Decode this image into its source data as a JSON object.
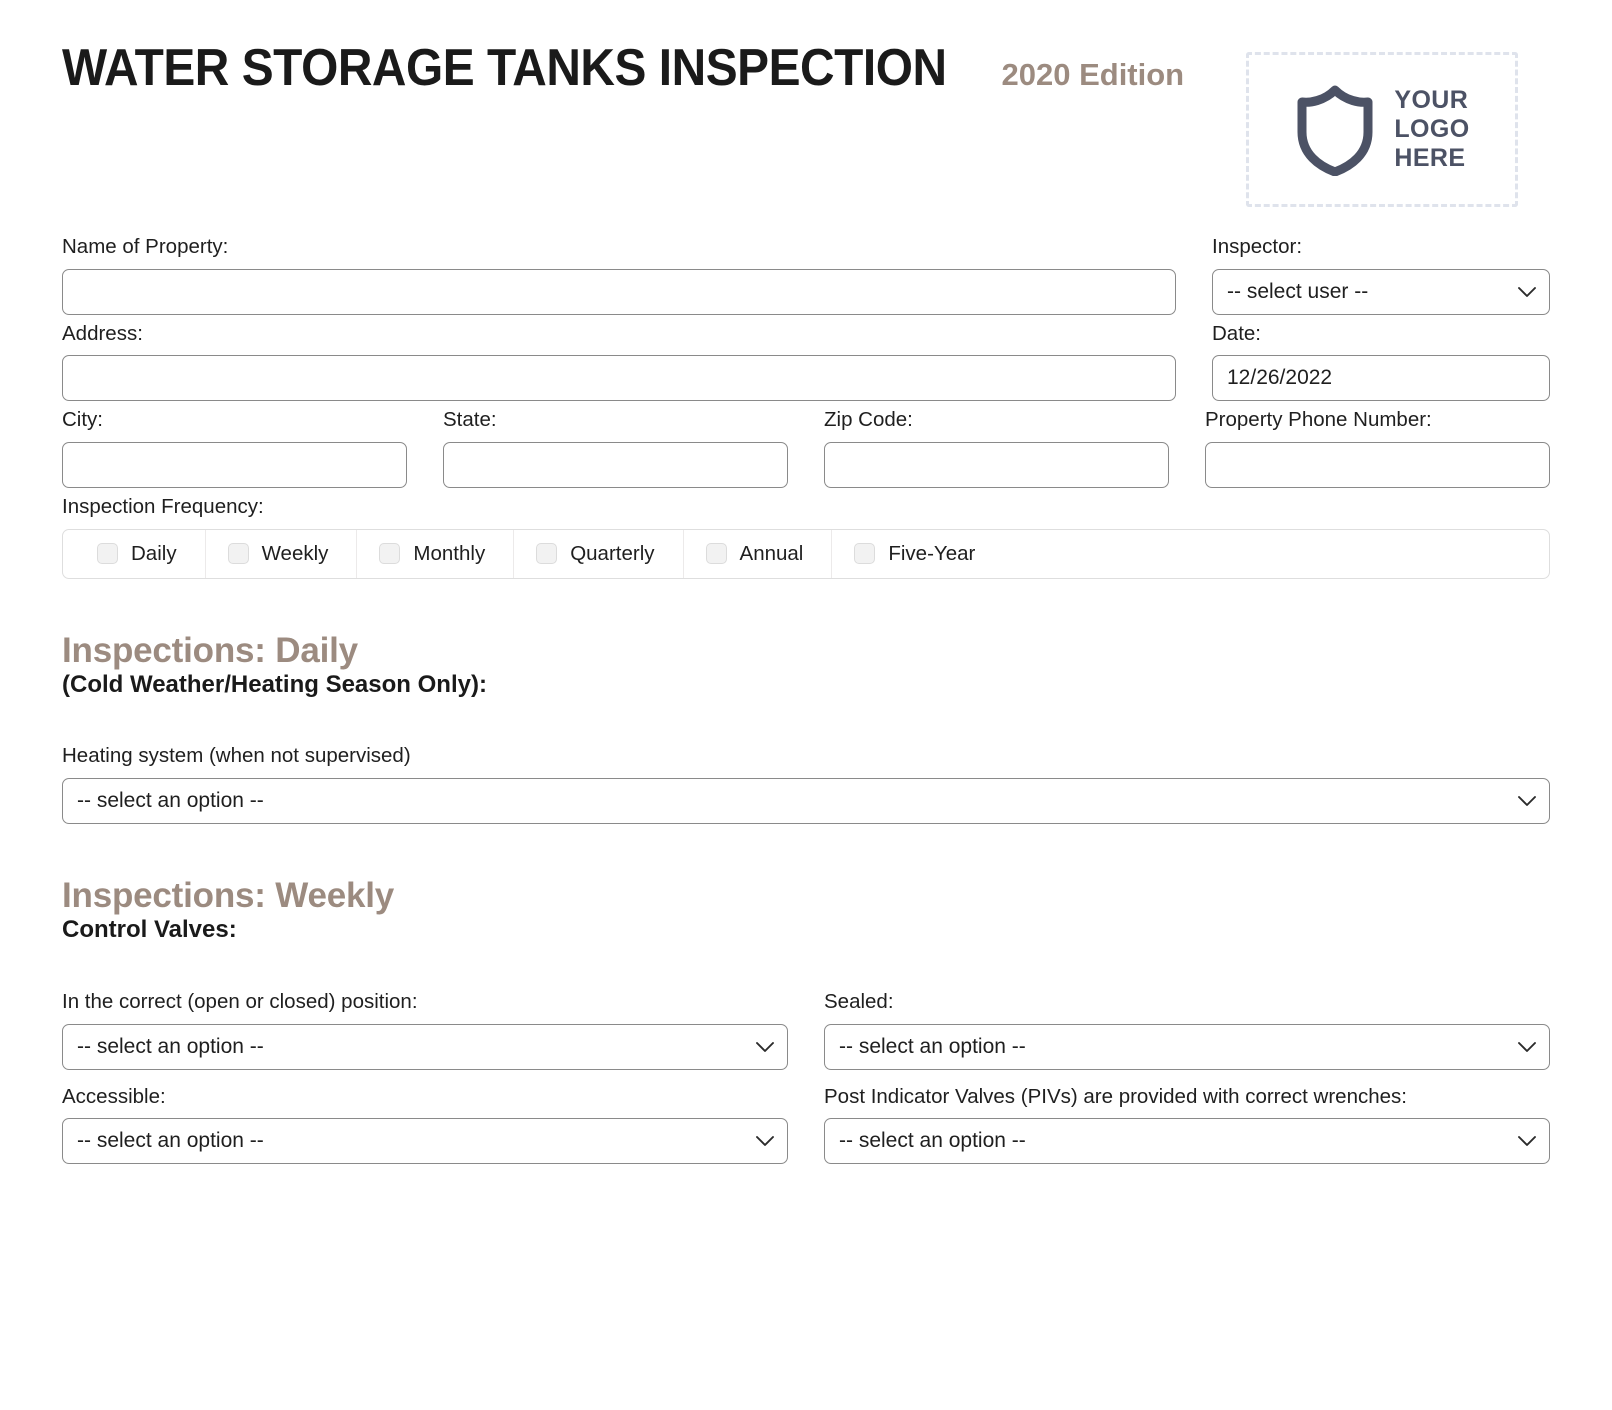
{
  "header": {
    "title": "WATER STORAGE TANKS INSPECTION",
    "edition": "2020 Edition",
    "logo": {
      "icon": "shield-icon",
      "line1": "YOUR",
      "line2": "LOGO",
      "line3": "HERE"
    }
  },
  "colors": {
    "accent_taupe": "#9c8b80",
    "text": "#1f1f1f",
    "border": "#8a8a8a",
    "logo_slate": "#4c5265",
    "logo_dash": "#dfe3ec"
  },
  "form": {
    "name_of_property": {
      "label": "Name of Property:",
      "value": "",
      "placeholder": ""
    },
    "inspector": {
      "label": "Inspector:",
      "value": "-- select user --"
    },
    "address": {
      "label": "Address:",
      "value": "",
      "placeholder": ""
    },
    "date": {
      "label": "Date:",
      "value": "12/26/2022"
    },
    "city": {
      "label": "City:",
      "value": "",
      "placeholder": ""
    },
    "state": {
      "label": "State:",
      "value": "",
      "placeholder": ""
    },
    "zip_code": {
      "label": "Zip Code:",
      "value": "",
      "placeholder": ""
    },
    "property_phone": {
      "label": "Property Phone Number:",
      "value": "",
      "placeholder": ""
    },
    "inspection_frequency": {
      "label": "Inspection Frequency:",
      "options": [
        {
          "label": "Daily",
          "checked": false
        },
        {
          "label": "Weekly",
          "checked": false
        },
        {
          "label": "Monthly",
          "checked": false
        },
        {
          "label": "Quarterly",
          "checked": false
        },
        {
          "label": "Annual",
          "checked": false
        },
        {
          "label": "Five-Year",
          "checked": false
        }
      ]
    }
  },
  "sections": {
    "daily": {
      "title": "Inspections: Daily",
      "subtitle": "(Cold Weather/Heating Season Only):",
      "heating_system": {
        "label": "Heating system (when not supervised)",
        "value": "-- select an option --"
      }
    },
    "weekly": {
      "title": "Inspections: Weekly",
      "subtitle": "Control Valves:",
      "questions": [
        {
          "label": "In the correct (open or closed) position:",
          "value": "-- select an option --"
        },
        {
          "label": "Sealed:",
          "value": "-- select an option --"
        },
        {
          "label": "Accessible:",
          "value": "-- select an option --"
        },
        {
          "label": "Post Indicator Valves (PIVs) are provided with correct wrenches:",
          "value": "-- select an option --"
        }
      ]
    }
  }
}
